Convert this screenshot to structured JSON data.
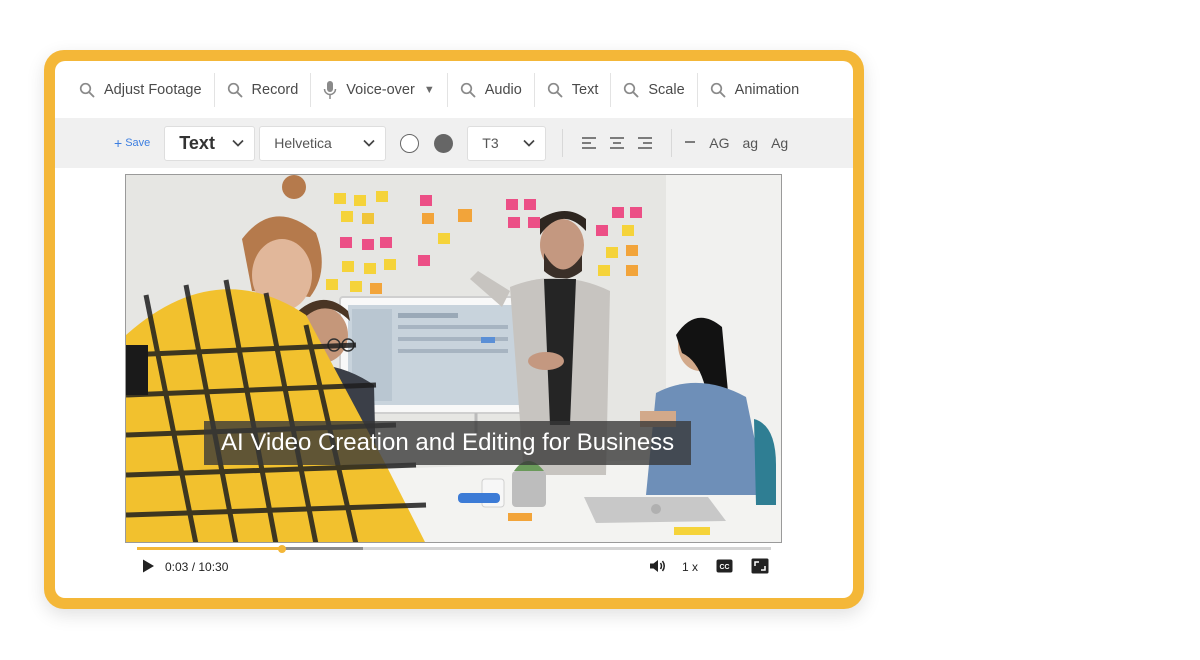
{
  "menu": {
    "items": [
      {
        "label": "Adjust Footage",
        "icon": "search-icon"
      },
      {
        "label": "Record",
        "icon": "search-icon"
      },
      {
        "label": "Voice-over",
        "icon": "microphone-icon",
        "caret": "▼"
      },
      {
        "label": "Audio",
        "icon": "search-icon"
      },
      {
        "label": "Text",
        "icon": "search-icon"
      },
      {
        "label": "Scale",
        "icon": "search-icon"
      },
      {
        "label": "Animation",
        "icon": "search-icon"
      }
    ]
  },
  "toolbar": {
    "save_label": "Save",
    "style_value": "Text",
    "font_value": "Helvetica",
    "size_value": "T3",
    "case_options": [
      "AG",
      "ag",
      "Ag"
    ]
  },
  "video": {
    "caption": "AI Video Creation and Editing for Business",
    "time": "0:03 / 10:30",
    "speed": "1 x",
    "progress_fraction": 0.228,
    "buffered_fraction": 0.357
  },
  "colors": {
    "frame": "#f4b738",
    "accent_blue": "#3c7ee0",
    "toolbar_bg": "#f0f0f0"
  }
}
